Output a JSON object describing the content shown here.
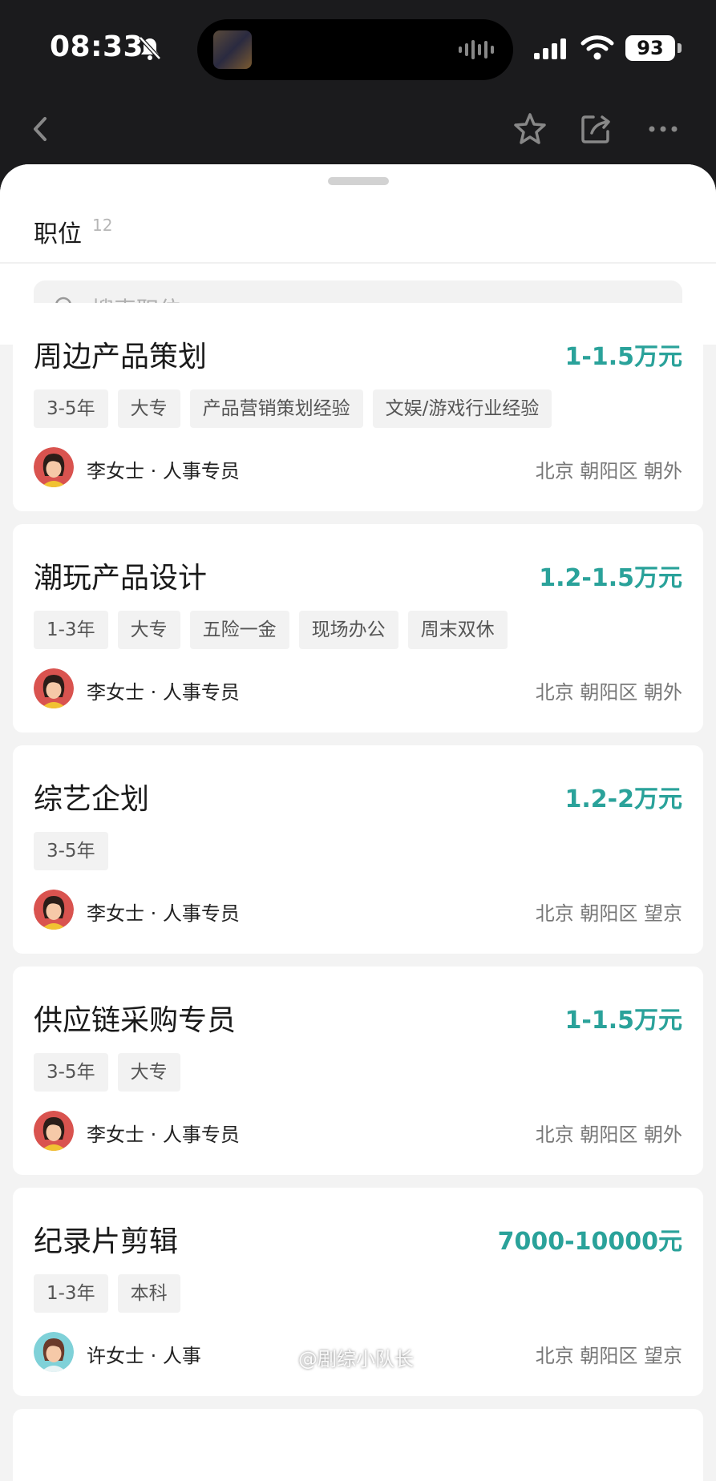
{
  "status_bar": {
    "time": "08:33",
    "battery": "93",
    "icons": [
      "bell-slash-icon",
      "signal-icon",
      "wifi-icon",
      "battery-icon"
    ]
  },
  "nav": {
    "icons": [
      "back-chevron-icon",
      "star-icon",
      "share-icon",
      "more-icon"
    ]
  },
  "sheet": {
    "tab_label": "职位",
    "tab_count": "12",
    "search_placeholder": "搜索职位"
  },
  "jobs": [
    {
      "title": "周边产品策划",
      "salary": "1-1.5万元",
      "tags": [
        "3-5年",
        "大专",
        "产品营销策划经验",
        "文娱/游戏行业经验"
      ],
      "recruiter": "李女士 · 人事专员",
      "location": "北京 朝阳区 朝外"
    },
    {
      "title": "潮玩产品设计",
      "salary": "1.2-1.5万元",
      "tags": [
        "1-3年",
        "大专",
        "五险一金",
        "现场办公",
        "周末双休"
      ],
      "recruiter": "李女士 · 人事专员",
      "location": "北京 朝阳区 朝外"
    },
    {
      "title": "综艺企划",
      "salary": "1.2-2万元",
      "tags": [
        "3-5年"
      ],
      "recruiter": "李女士 · 人事专员",
      "location": "北京 朝阳区 望京"
    },
    {
      "title": "供应链采购专员",
      "salary": "1-1.5万元",
      "tags": [
        "3-5年",
        "大专"
      ],
      "recruiter": "李女士 · 人事专员",
      "location": "北京 朝阳区 朝外"
    },
    {
      "title": "纪录片剪辑",
      "salary": "7000-10000元",
      "tags": [
        "1-3年",
        "本科"
      ],
      "recruiter": "许女士 · 人事",
      "location": "北京 朝阳区 望京"
    }
  ],
  "watermark": "@剧综小队长",
  "colors": {
    "salary": "#2aa29a",
    "background": "#f3f3f3",
    "status_bar": "#1b1b1d"
  }
}
